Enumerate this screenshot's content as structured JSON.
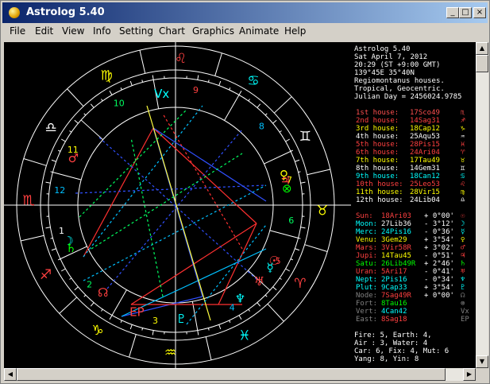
{
  "window": {
    "title": "Astrolog 5.40",
    "app_icon": "sun-icon",
    "buttons": {
      "minimize": "_",
      "maximize": "□",
      "close": "×"
    }
  },
  "menu": [
    "File",
    "Edit",
    "View",
    "Info",
    "Setting",
    "Chart",
    "Graphics",
    "Animate",
    "Help"
  ],
  "header": [
    "Astrolog 5.40",
    "Sat April 7, 2012",
    "20:29 (ST +9:00 GMT)",
    "139°45E 35°40N",
    "Regiomontanus houses.",
    "Tropical, Geocentric.",
    "Julian Day = 2456024.9785"
  ],
  "houses": [
    {
      "label": "1st house:",
      "value": "17Sco49",
      "sym": "♏",
      "color": "#ff5050"
    },
    {
      "label": "2nd house:",
      "value": "14Sag31",
      "sym": "♐",
      "color": "#ff4040"
    },
    {
      "label": "3rd house:",
      "value": "18Cap12",
      "sym": "♑",
      "color": "#ffff00"
    },
    {
      "label": "4th house:",
      "value": "25Aqu53",
      "sym": "♒",
      "color": "#ffffff"
    },
    {
      "label": "5th house:",
      "value": "28Pis15",
      "sym": "♓",
      "color": "#ff4040"
    },
    {
      "label": "6th house:",
      "value": "24Ari04",
      "sym": "♈",
      "color": "#ff4040"
    },
    {
      "label": "7th house:",
      "value": "17Tau49",
      "sym": "♉",
      "color": "#ffff00"
    },
    {
      "label": "8th house:",
      "value": "14Gem31",
      "sym": "♊",
      "color": "#ffffff"
    },
    {
      "label": "9th house:",
      "value": "18Can12",
      "sym": "♋",
      "color": "#00ffff"
    },
    {
      "label": "10th house:",
      "value": "25Leo53",
      "sym": "♌",
      "color": "#ff4040"
    },
    {
      "label": "11th house:",
      "value": "28Vir15",
      "sym": "♍",
      "color": "#ffff00"
    },
    {
      "label": "12th house:",
      "value": "24Lib04",
      "sym": "♎",
      "color": "#ffffff"
    }
  ],
  "planets": [
    {
      "name": "Sun:",
      "pos": "18Ari03",
      "lat": "+ 0°00'",
      "sym": "☉",
      "color": "#ff4040",
      "valcolor": "#ff4040"
    },
    {
      "name": "Moon:",
      "pos": "27Lib36",
      "lat": "- 3°12'",
      "sym": "☽",
      "color": "#00ffff",
      "valcolor": "#ffffff"
    },
    {
      "name": "Merc:",
      "pos": "24Pis16",
      "lat": "- 0°36'",
      "sym": "☿",
      "color": "#00ffff",
      "valcolor": "#00ffff"
    },
    {
      "name": "Venu:",
      "pos": "3Gem29",
      "lat": "+ 3°54'",
      "sym": "♀",
      "color": "#ffff00",
      "valcolor": "#ffff00"
    },
    {
      "name": "Mars:",
      "pos": "3Vir58R",
      "lat": "+ 3°02'",
      "sym": "♂",
      "color": "#ff4040",
      "valcolor": "#ff4040"
    },
    {
      "name": "Jupi:",
      "pos": "14Tau45",
      "lat": "- 0°51'",
      "sym": "♃",
      "color": "#ff4040",
      "valcolor": "#ffff00"
    },
    {
      "name": "Satu:",
      "pos": "26Lib49R",
      "lat": "+ 2°46'",
      "sym": "♄",
      "color": "#00ff00",
      "valcolor": "#00ff00"
    },
    {
      "name": "Uran:",
      "pos": "5Ari17",
      "lat": "- 0°41'",
      "sym": "♅",
      "color": "#ff4040",
      "valcolor": "#ff4040"
    },
    {
      "name": "Nept:",
      "pos": "2Pis16",
      "lat": "- 0°34'",
      "sym": "♆",
      "color": "#00ffff",
      "valcolor": "#00ffff"
    },
    {
      "name": "Plut:",
      "pos": "9Cap33",
      "lat": "+ 3°54'",
      "sym": "♇",
      "color": "#00ffff",
      "valcolor": "#00ffff"
    },
    {
      "name": "Node:",
      "pos": "7Sag49R",
      "lat": "+ 0°00'",
      "sym": "☊",
      "color": "#808080",
      "valcolor": "#ff4040"
    },
    {
      "name": "Fort:",
      "pos": "8Tau16",
      "lat": "",
      "sym": "⊗",
      "color": "#808080",
      "valcolor": "#00ff00"
    },
    {
      "name": "Vert:",
      "pos": "4Can42",
      "lat": "",
      "sym": "Vx",
      "color": "#808080",
      "valcolor": "#00ffff"
    },
    {
      "name": "East:",
      "pos": "8Sag18",
      "lat": "",
      "sym": "EP",
      "color": "#808080",
      "valcolor": "#ff4040"
    }
  ],
  "elements": [
    "Fire: 5, Earth: 4,",
    "Air : 3, Water: 4",
    "Car: 6, Fix: 4, Mut: 6",
    "Yang: 8, Yin: 8"
  ],
  "wheel": {
    "signs": [
      {
        "sym": "♏",
        "color": "#ff4040"
      },
      {
        "sym": "♐",
        "color": "#ff4040"
      },
      {
        "sym": "♑",
        "color": "#ffff00"
      },
      {
        "sym": "♒",
        "color": "#ffff00"
      },
      {
        "sym": "♓",
        "color": "#00ffff"
      },
      {
        "sym": "♈",
        "color": "#ff4040"
      },
      {
        "sym": "♉",
        "color": "#ffff00"
      },
      {
        "sym": "♊",
        "color": "#ffffff"
      },
      {
        "sym": "♋",
        "color": "#00ffff"
      },
      {
        "sym": "♌",
        "color": "#ff4040"
      },
      {
        "sym": "♍",
        "color": "#ffff00"
      },
      {
        "sym": "♎",
        "color": "#ffffff"
      }
    ],
    "house_numbers": [
      "1",
      "2",
      "3",
      "4",
      "5",
      "6",
      "7",
      "8",
      "9",
      "10",
      "11",
      "12"
    ],
    "planet_marks": [
      {
        "sym": "☉",
        "color": "#ff4040"
      },
      {
        "sym": "☽",
        "color": "#00ffff"
      },
      {
        "sym": "☿",
        "color": "#00ffff"
      },
      {
        "sym": "♀",
        "color": "#ffff00"
      },
      {
        "sym": "♂",
        "color": "#ff4040"
      },
      {
        "sym": "♃",
        "color": "#ff4040"
      },
      {
        "sym": "♄",
        "color": "#00ff00"
      },
      {
        "sym": "♅",
        "color": "#ff4040"
      },
      {
        "sym": "♆",
        "color": "#00ffff"
      },
      {
        "sym": "♇",
        "color": "#00ffff"
      },
      {
        "sym": "☊",
        "color": "#ff4040"
      },
      {
        "sym": "⊗",
        "color": "#00ff00"
      },
      {
        "sym": "Vx",
        "color": "#00ffff"
      },
      {
        "sym": "EP",
        "color": "#ff4040"
      }
    ]
  }
}
